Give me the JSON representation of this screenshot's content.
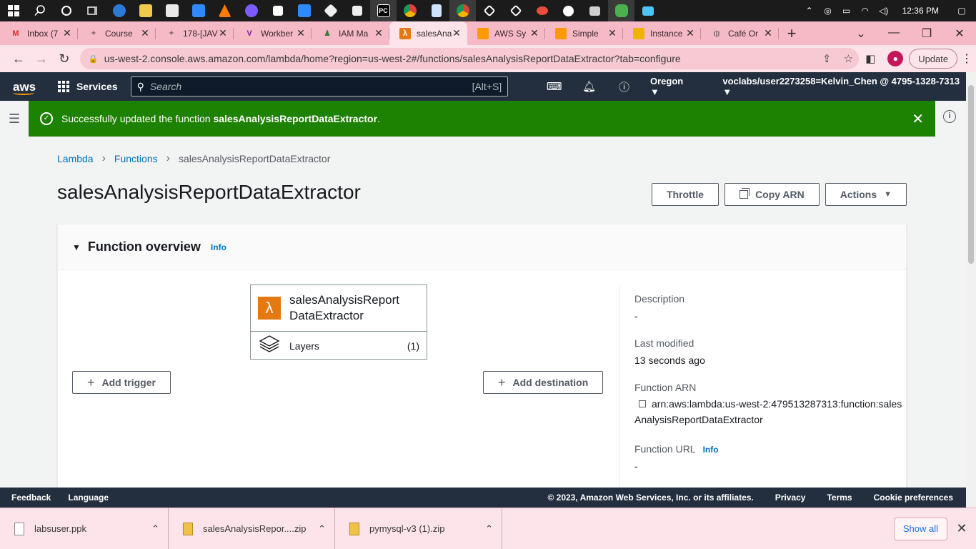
{
  "taskbar": {
    "time": "12:36 PM",
    "app_colors": [
      "#ffffff",
      "#ffffff",
      "#ffffff",
      "#ffffff",
      "#2b7bd6",
      "#f2c94c",
      "#e9e9e9",
      "#2f89fc",
      "#ff7a00",
      "#7c5cff",
      "#ffffff",
      "#2f89fc",
      "#eeeeee",
      "#eeeeee",
      "#ffffff",
      "#ffffff",
      "#e74c3c",
      "#ffffff",
      "#4caf50",
      "#2f89fc",
      "#4fc3f7"
    ]
  },
  "tabs": [
    {
      "label": "Inbox (7",
      "icon": "gmail-icon",
      "color": "#d93025"
    },
    {
      "label": "Course",
      "icon": "course-icon",
      "color": "#8d6e63"
    },
    {
      "label": "178-[JAV",
      "icon": "course-icon",
      "color": "#8d6e63"
    },
    {
      "label": "Workber",
      "icon": "vocareum-icon",
      "color": "#7b1fa2"
    },
    {
      "label": "IAM Ma",
      "icon": "iam-icon",
      "color": "#2e7d32"
    },
    {
      "label": "salesAna",
      "icon": "lambda-icon",
      "color": "#e47911",
      "active": true
    },
    {
      "label": "AWS Sy",
      "icon": "aws-box-icon",
      "color": "#ff9900"
    },
    {
      "label": "Simple",
      "icon": "aws-box-icon",
      "color": "#ff9900"
    },
    {
      "label": "Instance",
      "icon": "aws-box-icon",
      "color": "#f0b400"
    },
    {
      "label": "Café Or",
      "icon": "globe-icon",
      "color": "#5f6368"
    }
  ],
  "address": {
    "url": "us-west-2.console.aws.amazon.com/lambda/home?region=us-west-2#/functions/salesAnalysisReportDataExtractor?tab=configure",
    "update_label": "Update"
  },
  "awsnav": {
    "logo": "aws",
    "services": "Services",
    "search_placeholder": "Search",
    "search_shortcut": "[Alt+S]",
    "region": "Oregon",
    "account": "voclabs/user2273258=Kelvin_Chen @ 4795-1328-7313"
  },
  "flash": {
    "prefix": "Successfully updated the function ",
    "function": "salesAnalysisReportDataExtractor",
    "suffix": "."
  },
  "breadcrumb": {
    "lambda": "Lambda",
    "functions": "Functions",
    "current": "salesAnalysisReportDataExtractor"
  },
  "page": {
    "title": "salesAnalysisReportDataExtractor",
    "throttle": "Throttle",
    "copy_arn": "Copy ARN",
    "actions": "Actions"
  },
  "overview": {
    "title": "Function overview",
    "info": "Info",
    "function_name": "salesAnalysisReportDataExtractor",
    "function_name_line1": "salesAnalysisReport",
    "function_name_line2": "DataExtractor",
    "layers_label": "Layers",
    "layers_count": "(1)",
    "add_trigger": "Add trigger",
    "add_destination": "Add destination"
  },
  "details": {
    "description_label": "Description",
    "description_value": "-",
    "last_modified_label": "Last modified",
    "last_modified_value": "13 seconds ago",
    "arn_label": "Function ARN",
    "arn_value": "arn:aws:lambda:us-west-2:479513287313:function:salesAnalysisReportDataExtractor",
    "url_label": "Function URL",
    "url_info": "Info",
    "url_value": "-"
  },
  "footer": {
    "feedback": "Feedback",
    "language": "Language",
    "copyright": "© 2023, Amazon Web Services, Inc. or its affiliates.",
    "privacy": "Privacy",
    "terms": "Terms",
    "cookies": "Cookie preferences"
  },
  "downloads": {
    "items": [
      {
        "name": "labsuser.ppk"
      },
      {
        "name": "salesAnalysisRepor....zip"
      },
      {
        "name": "pymysql-v3 (1).zip"
      }
    ],
    "show_all": "Show all"
  },
  "colors": {
    "aws_nav": "#232f3e",
    "aws_orange": "#ff9900",
    "success": "#1d8102",
    "link": "#0073bb"
  }
}
